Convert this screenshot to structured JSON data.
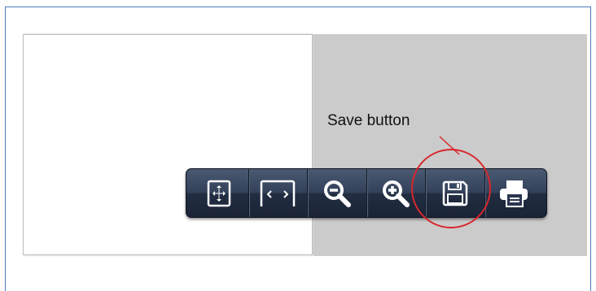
{
  "annotation": {
    "label": "Save button",
    "circle_color": "#d9262c"
  },
  "toolbar": {
    "colors": {
      "background": "#2a3650",
      "icon": "#ffffff"
    },
    "buttons": [
      {
        "id": "fit-page",
        "icon": "fit-page-icon"
      },
      {
        "id": "fit-width",
        "icon": "fit-width-icon"
      },
      {
        "id": "zoom-out",
        "icon": "zoom-out-icon"
      },
      {
        "id": "zoom-in",
        "icon": "zoom-in-icon"
      },
      {
        "id": "save",
        "icon": "save-icon"
      },
      {
        "id": "print",
        "icon": "print-icon"
      }
    ]
  }
}
